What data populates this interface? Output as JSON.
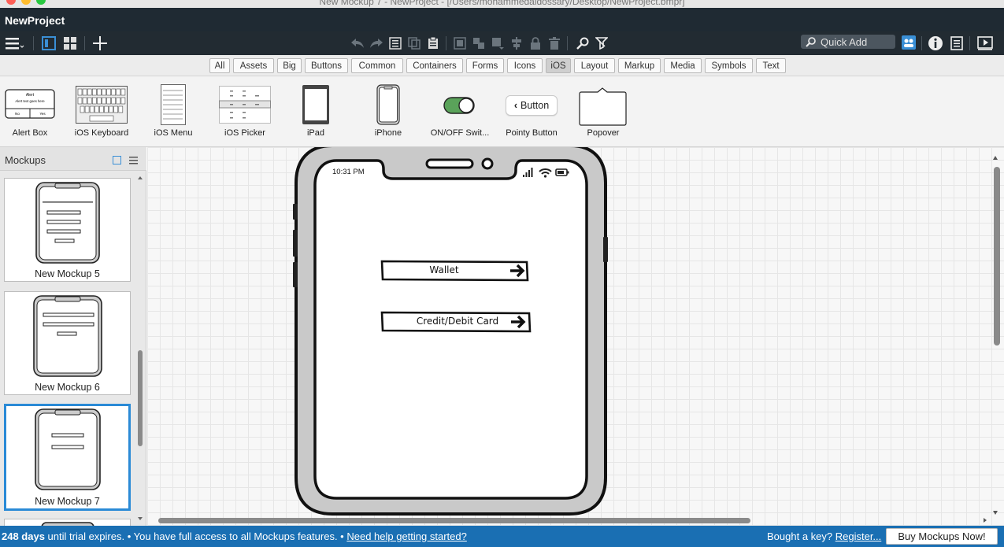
{
  "window": {
    "title": "New Mockup 7 - NewProject - [/Users/mohammedaldossary/Desktop/NewProject.bmpr]"
  },
  "project": {
    "name": "NewProject"
  },
  "toolbar": {
    "quick_add": "Quick Add"
  },
  "filters": [
    "All",
    "Assets",
    "Big",
    "Buttons",
    "Common",
    "Containers",
    "Forms",
    "Icons",
    "iOS",
    "Layout",
    "Markup",
    "Media",
    "Symbols",
    "Text"
  ],
  "filter_selected": "iOS",
  "library": {
    "items": [
      "Alert Box",
      "iOS Keyboard",
      "iOS Menu",
      "iOS Picker",
      "iPad",
      "iPhone",
      "ON/OFF Swit...",
      "Pointy Button",
      "Popover"
    ],
    "alert_title": "Alert",
    "alert_text": "Alert text goes here",
    "alert_no": "No",
    "alert_yes": "Yes",
    "pointy_button_label": "Button"
  },
  "sidebar": {
    "title": "Mockups",
    "mockups": [
      "New Mockup 5",
      "New Mockup 6",
      "New Mockup 7"
    ],
    "selected": "New Mockup 7"
  },
  "canvas": {
    "phone_time": "10:31 PM",
    "wallet_label": "Wallet",
    "card_label": "Credit/Debit Card"
  },
  "status": {
    "days": "248 days",
    "trial_text": " until trial expires. • You have full access to all Mockups features. • ",
    "help_link": "Need help getting started?",
    "key_text": "Bought a key? ",
    "register_link": "Register...",
    "buy_button": "Buy Mockups Now!"
  },
  "colors": {
    "toolbar": "#222b32",
    "status": "#1a6fb3",
    "selection": "#2a8ad6",
    "switch_on": "#5aa35a"
  }
}
